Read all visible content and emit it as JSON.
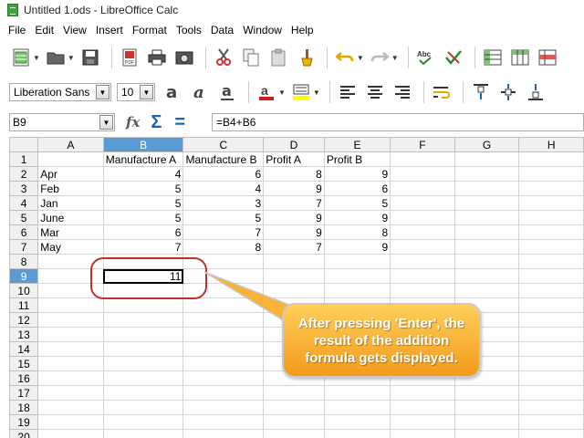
{
  "window": {
    "title": "Untitled 1.ods - LibreOffice Calc"
  },
  "menu": [
    "File",
    "Edit",
    "View",
    "Insert",
    "Format",
    "Tools",
    "Data",
    "Window",
    "Help"
  ],
  "formatting": {
    "font_name": "Liberation Sans",
    "font_size": "10"
  },
  "formula_bar": {
    "name_box": "B9",
    "formula": "=B4+B6"
  },
  "columns": [
    "A",
    "B",
    "C",
    "D",
    "E",
    "F",
    "G",
    "H"
  ],
  "rows": [
    [
      "",
      "Manufacture A",
      "Manufacture B",
      "Profit A",
      "Profit B",
      "",
      "",
      ""
    ],
    [
      "Apr",
      "4",
      "6",
      "8",
      "9",
      "",
      "",
      ""
    ],
    [
      "Feb",
      "5",
      "4",
      "9",
      "6",
      "",
      "",
      ""
    ],
    [
      "Jan",
      "5",
      "3",
      "7",
      "5",
      "",
      "",
      ""
    ],
    [
      "June",
      "5",
      "5",
      "9",
      "9",
      "",
      "",
      ""
    ],
    [
      "Mar",
      "6",
      "7",
      "9",
      "8",
      "",
      "",
      ""
    ],
    [
      "May",
      "7",
      "8",
      "7",
      "9",
      "",
      "",
      ""
    ],
    [
      "",
      "",
      "",
      "",
      "",
      "",
      "",
      ""
    ],
    [
      "",
      "11",
      "",
      "",
      "",
      "",
      "",
      ""
    ],
    [
      "",
      "",
      "",
      "",
      "",
      "",
      "",
      ""
    ],
    [
      "",
      "",
      "",
      "",
      "",
      "",
      "",
      ""
    ],
    [
      "",
      "",
      "",
      "",
      "",
      "",
      "",
      ""
    ],
    [
      "",
      "",
      "",
      "",
      "",
      "",
      "",
      ""
    ],
    [
      "",
      "",
      "",
      "",
      "",
      "",
      "",
      ""
    ],
    [
      "",
      "",
      "",
      "",
      "",
      "",
      "",
      ""
    ],
    [
      "",
      "",
      "",
      "",
      "",
      "",
      "",
      ""
    ],
    [
      "",
      "",
      "",
      "",
      "",
      "",
      "",
      ""
    ],
    [
      "",
      "",
      "",
      "",
      "",
      "",
      "",
      ""
    ],
    [
      "",
      "",
      "",
      "",
      "",
      "",
      "",
      ""
    ],
    [
      "",
      "",
      "",
      "",
      "",
      "",
      "",
      ""
    ]
  ],
  "selection": {
    "column": "B",
    "row": 9
  },
  "callout": {
    "text": "After pressing 'Enter', the result of the addition formula gets displayed."
  },
  "colors": {
    "selection_header": "#5b9bd5",
    "callout_fill": "#f7a92a",
    "highlight_ring": "#c0302a"
  }
}
